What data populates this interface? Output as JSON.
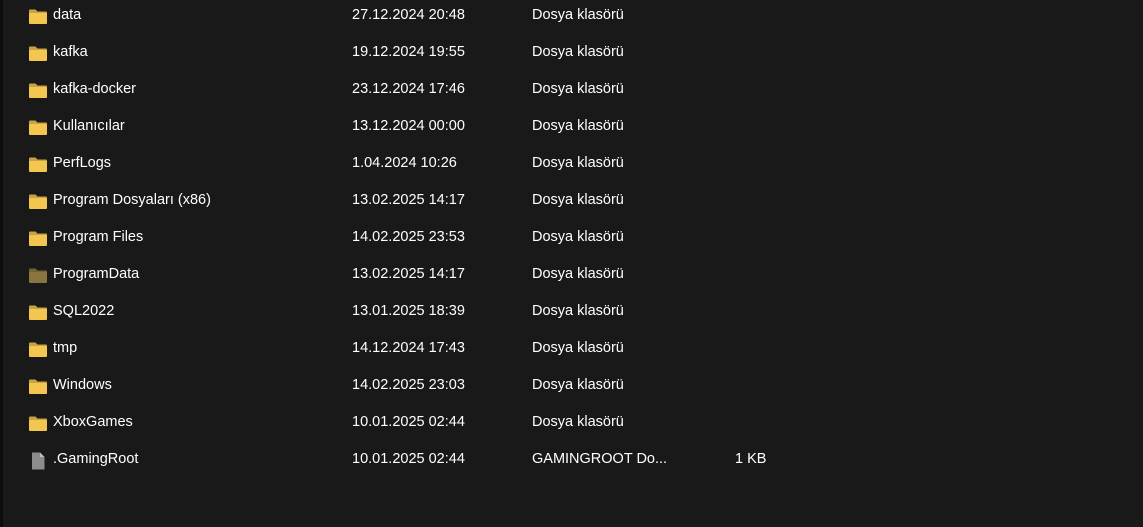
{
  "files": [
    {
      "name": "data",
      "date": "27.12.2024 20:48",
      "type": "Dosya klasörü",
      "size": "",
      "icon": "folder-icon",
      "icon_color": "#f3c64f"
    },
    {
      "name": "kafka",
      "date": "19.12.2024 19:55",
      "type": "Dosya klasörü",
      "size": "",
      "icon": "folder-icon",
      "icon_color": "#f3c64f"
    },
    {
      "name": "kafka-docker",
      "date": "23.12.2024 17:46",
      "type": "Dosya klasörü",
      "size": "",
      "icon": "folder-icon",
      "icon_color": "#f3c64f"
    },
    {
      "name": "Kullanıcılar",
      "date": "13.12.2024 00:00",
      "type": "Dosya klasörü",
      "size": "",
      "icon": "folder-icon",
      "icon_color": "#f3c64f"
    },
    {
      "name": "PerfLogs",
      "date": "1.04.2024 10:26",
      "type": "Dosya klasörü",
      "size": "",
      "icon": "folder-icon",
      "icon_color": "#f3c64f"
    },
    {
      "name": "Program Dosyaları (x86)",
      "date": "13.02.2025 14:17",
      "type": "Dosya klasörü",
      "size": "",
      "icon": "folder-icon",
      "icon_color": "#f3c64f"
    },
    {
      "name": "Program Files",
      "date": "14.02.2025 23:53",
      "type": "Dosya klasörü",
      "size": "",
      "icon": "folder-icon",
      "icon_color": "#f3c64f"
    },
    {
      "name": "ProgramData",
      "date": "13.02.2025 14:17",
      "type": "Dosya klasörü",
      "size": "",
      "icon": "hidden-folder-icon",
      "icon_color": "#8a7440"
    },
    {
      "name": "SQL2022",
      "date": "13.01.2025 18:39",
      "type": "Dosya klasörü",
      "size": "",
      "icon": "folder-icon",
      "icon_color": "#f3c64f"
    },
    {
      "name": "tmp",
      "date": "14.12.2024 17:43",
      "type": "Dosya klasörü",
      "size": "",
      "icon": "folder-icon",
      "icon_color": "#f3c64f"
    },
    {
      "name": "Windows",
      "date": "14.02.2025 23:03",
      "type": "Dosya klasörü",
      "size": "",
      "icon": "folder-icon",
      "icon_color": "#f3c64f"
    },
    {
      "name": "XboxGames",
      "date": "10.01.2025 02:44",
      "type": "Dosya klasörü",
      "size": "",
      "icon": "folder-icon",
      "icon_color": "#f3c64f"
    },
    {
      "name": ".GamingRoot",
      "date": "10.01.2025 02:44",
      "type": "GAMINGROOT Do...",
      "size": "1 KB",
      "icon": "file-icon",
      "icon_color": "#8c8c8c"
    }
  ]
}
